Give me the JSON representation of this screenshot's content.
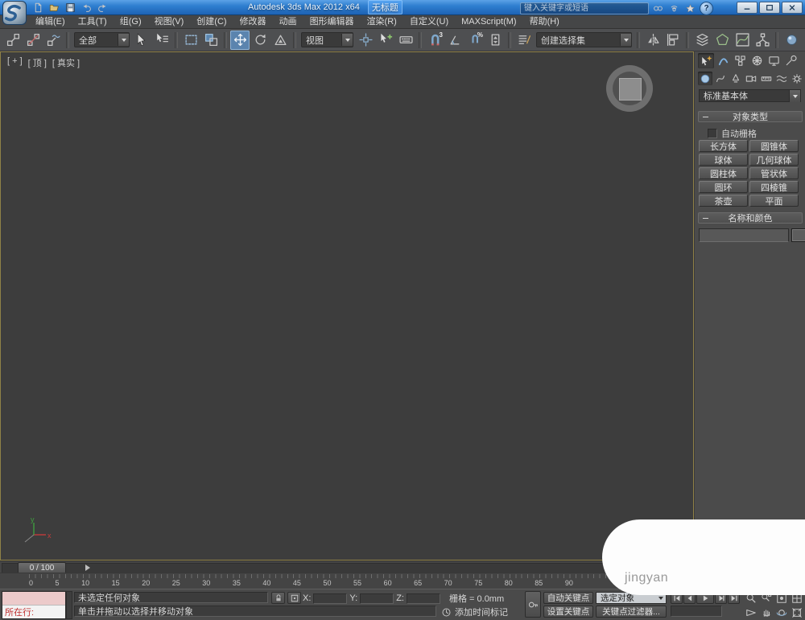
{
  "window": {
    "app_title": "Autodesk 3ds Max  2012 x64",
    "doc_title": "无标题",
    "search_placeholder": "键入关键字或短语",
    "help_glyph": "?"
  },
  "menus": [
    "编辑(E)",
    "工具(T)",
    "组(G)",
    "视图(V)",
    "创建(C)",
    "修改器",
    "动画",
    "图形编辑器",
    "渲染(R)",
    "自定义(U)",
    "MAXScript(M)",
    "帮助(H)"
  ],
  "toolbar": {
    "selection_filter": "全部",
    "ref_coord": "视图",
    "named_sets": "创建选择集",
    "snap_count": "3",
    "snap_percent": "%"
  },
  "viewport": {
    "label_plus": "[ + ]",
    "label_view": "[ 顶 ]",
    "label_shading": "[ 真实 ]",
    "axis_x": "x",
    "axis_y": "y"
  },
  "panel": {
    "category_dropdown": "标准基本体",
    "rollout_object_type": "对象类型",
    "autogrid_label": "自动栅格",
    "object_buttons": [
      "长方体",
      "圆锥体",
      "球体",
      "几何球体",
      "圆柱体",
      "管状体",
      "圆环",
      "四棱锥",
      "茶壶",
      "平面"
    ],
    "rollout_name_color": "名称和颜色",
    "name_value": ""
  },
  "timeline": {
    "slider_label": "0 / 100",
    "ruler_numbers": [
      "0",
      "5",
      "10",
      "15",
      "20",
      "25",
      "30",
      "35",
      "40",
      "45",
      "50",
      "55",
      "60",
      "65",
      "70",
      "75",
      "80",
      "85",
      "90"
    ]
  },
  "status": {
    "listener_text": "所在行:",
    "status_line": "未选定任何对象",
    "prompt_line": "单击并拖动以选择并移动对象",
    "x_label": "X:",
    "y_label": "Y:",
    "z_label": "Z:",
    "x_value": "",
    "y_value": "",
    "z_value": "",
    "grid_label": "栅格 = 0.0mm",
    "add_time_tag": "添加时间标记",
    "auto_key": "自动关键点",
    "set_key": "设置关键点",
    "selected_filter": "选定对象",
    "key_filters": "关键点过滤器...",
    "frame_value": ""
  },
  "watermark": {
    "text": "jingyan"
  },
  "colors": {
    "accent_blue": "#5b84ae",
    "titlebar_blue": "#2f7fd0",
    "active_viewport_border": "#8f8147",
    "listener_pink": "#eccaca"
  }
}
